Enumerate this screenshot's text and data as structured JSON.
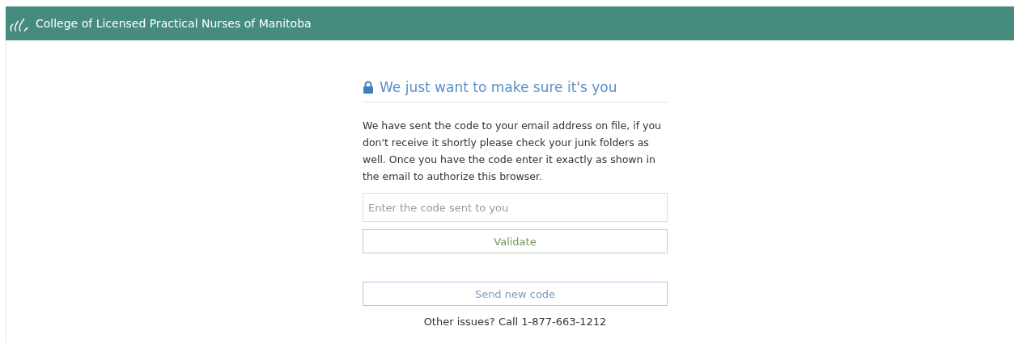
{
  "header": {
    "title": "College of Licensed Practical Nurses of Manitoba"
  },
  "panel": {
    "heading": "We just want to make sure it's you",
    "message": "We have sent the code to your email address on file, if you don't receive it shortly please check your junk folders as well. Once you have the code enter it exactly as shown in the email to authorize this browser.",
    "code_field": {
      "placeholder": "Enter the code sent to you"
    },
    "buttons": [
      {
        "label": "Validate",
        "kind": "success"
      },
      {
        "label": "Send new code",
        "kind": "info"
      }
    ],
    "footer_note": "Other issues? Call 1-877-663-1212"
  }
}
